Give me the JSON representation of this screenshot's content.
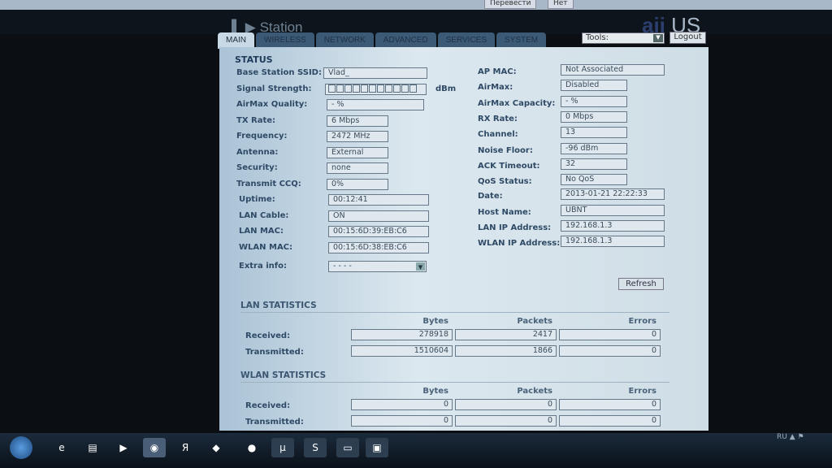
{
  "translate_bar": {
    "translate": "Перевести",
    "no": "Нет"
  },
  "header": {
    "logo": "Station",
    "brand": "US"
  },
  "tabs": [
    "MAIN",
    "WIRELESS",
    "NETWORK",
    "ADVANCED",
    "SERVICES",
    "SYSTEM"
  ],
  "tools": {
    "label": "Tools:",
    "logout": "Logout"
  },
  "status": {
    "title": "STATUS",
    "left": [
      {
        "label": "Base Station SSID:",
        "value": "Vlad_"
      },
      {
        "label": "Signal Strength:",
        "value": "",
        "unit": "dBm"
      },
      {
        "label": "AirMax Quality:",
        "value": "- %"
      },
      {
        "label": "TX Rate:",
        "value": "6 Mbps"
      },
      {
        "label": "Frequency:",
        "value": "2472 MHz"
      },
      {
        "label": "Antenna:",
        "value": "External"
      },
      {
        "label": "Security:",
        "value": "none"
      },
      {
        "label": "Transmit CCQ:",
        "value": " 0%"
      },
      {
        "label": "Uptime:",
        "value": "00:12:41"
      },
      {
        "label": "LAN Cable:",
        "value": "ON"
      },
      {
        "label": "LAN MAC:",
        "value": "00:15:6D:39:EB:C6"
      },
      {
        "label": "WLAN MAC:",
        "value": "00:15:6D:38:EB:C6"
      },
      {
        "label": "Extra info:",
        "value": "- - - -"
      }
    ],
    "right": [
      {
        "label": "AP MAC:",
        "value": "Not Associated"
      },
      {
        "label": "AirMax:",
        "value": "Disabled"
      },
      {
        "label": "AirMax Capacity:",
        "value": "- %"
      },
      {
        "label": "RX Rate:",
        "value": "0 Mbps"
      },
      {
        "label": "Channel:",
        "value": "13"
      },
      {
        "label": "Noise Floor:",
        "value": "-96 dBm"
      },
      {
        "label": "ACK Timeout:",
        "value": "32"
      },
      {
        "label": "QoS Status:",
        "value": "No QoS"
      },
      {
        "label": "Date:",
        "value": "2013-01-21 22:22:33"
      },
      {
        "label": "Host Name:",
        "value": "UBNT"
      },
      {
        "label": "LAN IP Address:",
        "value": "192.168.1.3"
      },
      {
        "label": "WLAN IP Address:",
        "value": "192.168.1.3"
      }
    ],
    "refresh": "Refresh"
  },
  "lan_stats": {
    "title": "LAN STATISTICS",
    "headers": [
      "Bytes",
      "Packets",
      "Errors"
    ],
    "rows": [
      {
        "label": "Received:",
        "values": [
          "278918",
          "2417",
          "0"
        ]
      },
      {
        "label": "Transmitted:",
        "values": [
          "1510604",
          "1866",
          "0"
        ]
      }
    ]
  },
  "wlan_stats": {
    "title": "WLAN STATISTICS",
    "headers": [
      "Bytes",
      "Packets",
      "Errors"
    ],
    "rows": [
      {
        "label": "Received:",
        "values": [
          "0",
          "0",
          "0"
        ]
      },
      {
        "label": "Transmitted:",
        "values": [
          "0",
          "0",
          "0"
        ]
      }
    ]
  },
  "tray": {
    "lang": "RU"
  }
}
